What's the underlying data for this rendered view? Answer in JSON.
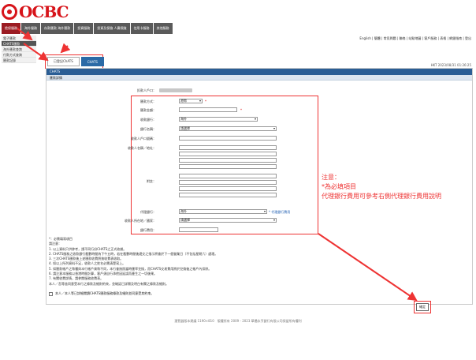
{
  "header": {
    "brand": "OCBC",
    "nav_tabs": [
      "擔保服務",
      "海外服務",
      "存款匯款 海外匯款",
      "投資服務",
      "投資及保險 人壽保險",
      "信用卡服務",
      "其他服務"
    ],
    "quicklinks": "English | 簡體 | 常見問題 | 聯絡 | 站點地圖 | 客戶服務 | 表格 | 網銀指南 | 登出"
  },
  "sidebar": {
    "items": [
      "電子匯款",
      "CHATS匯款",
      "海外匯款查詢",
      "付款方式查詢",
      "匯款記錄"
    ]
  },
  "subtabs": [
    "已登記ChATS",
    "CHATS"
  ],
  "market_time": "HKT 2023/08/31 01:26:25",
  "panel": {
    "title": "CHATS",
    "subtitle": "匯款詳情",
    "labels": {
      "payer_account": "扣款人戶口：",
      "currency": "匯款方式：",
      "amount": "匯款金額：",
      "bank_location": "收款銀行：",
      "bank_name": "銀行名稱：",
      "payee_account": "收款人戶口號碼：",
      "payee_name": "收款人名稱／地址：",
      "remarks": "附註：",
      "agent_bank": "代理銀行：",
      "agent_country": "收款人所在地／國家：",
      "charges": "銀行費用："
    },
    "values": {
      "currency": "港幣",
      "bank_location": "海外",
      "bank_name": "請選擇",
      "agent_bank": "海外",
      "agent_country": "請選擇",
      "charges": ""
    },
    "agent_bank_link": "* 代理銀行費用",
    "note_lines": [
      "注意：",
      "*為必填項目",
      "代理銀行費用可參考右側代理銀行費用說明"
    ],
    "notes_title": "*：必需填寫項目",
    "notes": [
      "請注意：",
      "1. 以上資料只供參考，請不同行份CHATS之正式收據。",
      "2. CHATS服務之收款銀行截數時間為下午五時，若在截數時間後遞交之指示將會於下一個營業日（不包括星期六）處理。",
      "3. 三次CHATS匯款後上述匯款收費將按收費表收取。",
      "4. 如以上所列資料不足，收款人之姓名必需清楚寫上。",
      "5. 如匯款帳戶之幣種與本行帳戶貨幣不同，本行會按照當時匯率兌換，而CHATS交易費用將於兌換後之帳戶內扣除。",
      "6. 請注意本服務以香港時間計算，客戶須自行承擔因延誤而產生之一切後果。",
      "7. 有關收費詳情，請參閱服務收費表。"
    ],
    "terms": "本人／吾等茲同意受本行之條款及細則約束，並確認已詳閱及明白有關之條款及細則。",
    "agree_text": "本人／本人等已詳細閱讀CHATS匯款服務條款及細則並同意受其約束。",
    "submit_label": "確定"
  },
  "footer": "瀏覽器版本建議 1190×810　版權所有 2009 - 2023 華僑永亨銀行有限公司保留所有權利"
}
